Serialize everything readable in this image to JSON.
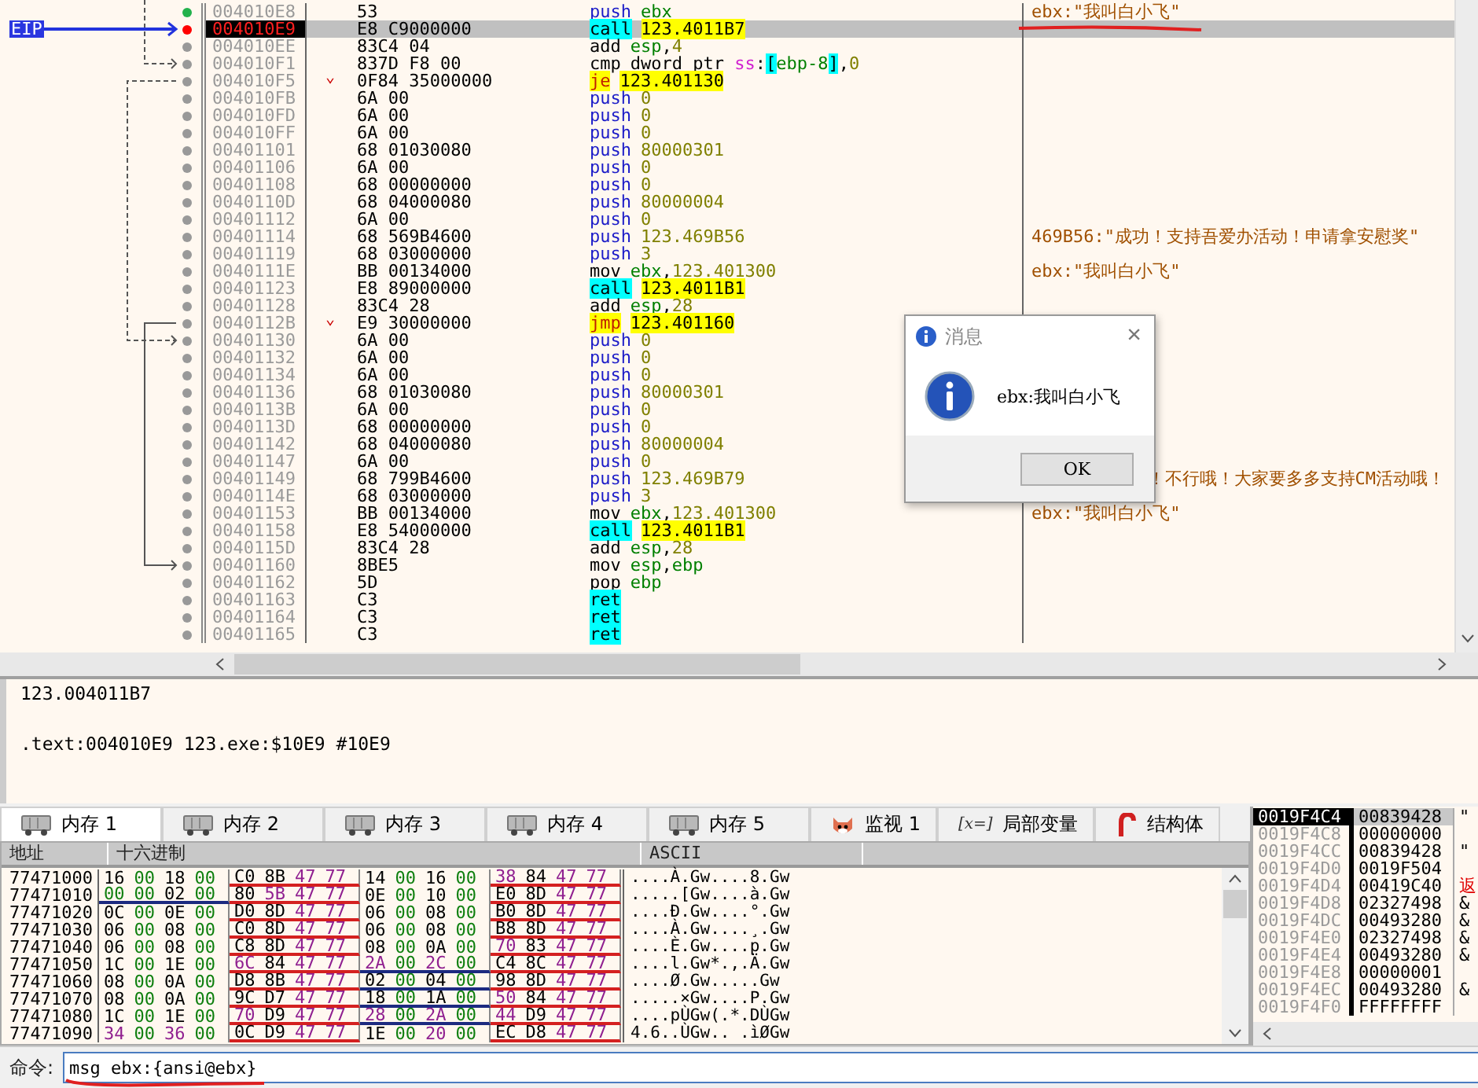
{
  "disassembly": {
    "eip_label": "EIP",
    "rows": [
      {
        "address": "004010E8",
        "bytes": "53",
        "kind": "push",
        "mnemonic": "push",
        "operand": [
          {
            "text": "ebx",
            "kind": "register"
          }
        ],
        "comment": "ebx:\"我叫白小飞\"",
        "color": "#22b14c",
        "selected": false
      },
      {
        "address": "004010E9",
        "bytes": "E8 C9000000",
        "kind": "call",
        "mnemonic": "call",
        "operand": [
          {
            "text": "123.4011B7",
            "kind": "target"
          }
        ],
        "color": "#ff0000",
        "selected": true
      },
      {
        "address": "004010EE",
        "bytes": "83C4 04",
        "kind": "plain",
        "mnemonic": "add",
        "operand": [
          {
            "text": "esp",
            "kind": "register"
          },
          {
            "text": ",",
            "kind": "plain"
          },
          {
            "text": "4",
            "kind": "number"
          }
        ],
        "color": "#999999",
        "selected": false
      },
      {
        "address": "004010F1",
        "bytes": "837D F8 00",
        "kind": "plain",
        "mnemonic": "cmp",
        "operand": [
          {
            "text": "dword ptr ",
            "kind": "plain"
          },
          {
            "text": "ss",
            "kind": "segment"
          },
          {
            "text": ":",
            "kind": "plain"
          },
          {
            "text": "[",
            "kind": "bracket"
          },
          {
            "text": "ebp-8",
            "kind": "register"
          },
          {
            "text": "]",
            "kind": "bracket"
          },
          {
            "text": ",",
            "kind": "plain"
          },
          {
            "text": "0",
            "kind": "number"
          }
        ],
        "color": "#999999",
        "selected": false
      },
      {
        "address": "004010F5",
        "bytes": "0F84 35000000",
        "jump_mark": "⌄",
        "kind": "jump",
        "mnemonic": "je",
        "operand": [
          {
            "text": "123.401130",
            "kind": "target"
          }
        ],
        "color": "#999999",
        "selected": false
      },
      {
        "address": "004010FB",
        "bytes": "6A 00",
        "kind": "push",
        "mnemonic": "push",
        "operand": [
          {
            "text": "0",
            "kind": "number"
          }
        ],
        "color": "#999999",
        "selected": false
      },
      {
        "address": "004010FD",
        "bytes": "6A 00",
        "kind": "push",
        "mnemonic": "push",
        "operand": [
          {
            "text": "0",
            "kind": "number"
          }
        ],
        "color": "#999999",
        "selected": false
      },
      {
        "address": "004010FF",
        "bytes": "6A 00",
        "kind": "push",
        "mnemonic": "push",
        "operand": [
          {
            "text": "0",
            "kind": "number"
          }
        ],
        "color": "#999999",
        "selected": false
      },
      {
        "address": "00401101",
        "bytes": "68 01030080",
        "kind": "push",
        "mnemonic": "push",
        "operand": [
          {
            "text": "80000301",
            "kind": "number"
          }
        ],
        "color": "#999999",
        "selected": false
      },
      {
        "address": "00401106",
        "bytes": "6A 00",
        "kind": "push",
        "mnemonic": "push",
        "operand": [
          {
            "text": "0",
            "kind": "number"
          }
        ],
        "color": "#999999",
        "selected": false
      },
      {
        "address": "00401108",
        "bytes": "68 00000000",
        "kind": "push",
        "mnemonic": "push",
        "operand": [
          {
            "text": "0",
            "kind": "number"
          }
        ],
        "color": "#999999",
        "selected": false
      },
      {
        "address": "0040110D",
        "bytes": "68 04000080",
        "kind": "push",
        "mnemonic": "push",
        "operand": [
          {
            "text": "80000004",
            "kind": "number"
          }
        ],
        "color": "#999999",
        "selected": false
      },
      {
        "address": "00401112",
        "bytes": "6A 00",
        "kind": "push",
        "mnemonic": "push",
        "operand": [
          {
            "text": "0",
            "kind": "number"
          }
        ],
        "color": "#999999",
        "selected": false
      },
      {
        "address": "00401114",
        "bytes": "68 569B4600",
        "kind": "push",
        "mnemonic": "push",
        "operand": [
          {
            "text": "123.469B56",
            "kind": "number"
          }
        ],
        "comment": "469B56:\"成功！支持吾爱办活动！申请拿安慰奖\"",
        "color": "#999999",
        "selected": false
      },
      {
        "address": "00401119",
        "bytes": "68 03000000",
        "kind": "push",
        "mnemonic": "push",
        "operand": [
          {
            "text": "3",
            "kind": "number"
          }
        ],
        "color": "#999999",
        "selected": false
      },
      {
        "address": "0040111E",
        "bytes": "BB 00134000",
        "kind": "plain",
        "mnemonic": "mov",
        "operand": [
          {
            "text": "ebx",
            "kind": "register"
          },
          {
            "text": ",",
            "kind": "plain"
          },
          {
            "text": "123.401300",
            "kind": "number"
          }
        ],
        "comment": "ebx:\"我叫白小飞\"",
        "color": "#999999",
        "selected": false
      },
      {
        "address": "00401123",
        "bytes": "E8 89000000",
        "kind": "call",
        "mnemonic": "call",
        "operand": [
          {
            "text": "123.4011B1",
            "kind": "target"
          }
        ],
        "color": "#999999",
        "selected": false
      },
      {
        "address": "00401128",
        "bytes": "83C4 28",
        "kind": "plain",
        "mnemonic": "add",
        "operand": [
          {
            "text": "esp",
            "kind": "register"
          },
          {
            "text": ",",
            "kind": "plain"
          },
          {
            "text": "28",
            "kind": "number"
          }
        ],
        "color": "#999999",
        "selected": false
      },
      {
        "address": "0040112B",
        "bytes": "E9 30000000",
        "jump_mark": "⌄",
        "kind": "jump",
        "mnemonic": "jmp",
        "operand": [
          {
            "text": "123.401160",
            "kind": "target"
          }
        ],
        "color": "#999999",
        "selected": false
      },
      {
        "address": "00401130",
        "bytes": "6A 00",
        "kind": "push",
        "mnemonic": "push",
        "operand": [
          {
            "text": "0",
            "kind": "number"
          }
        ],
        "color": "#999999",
        "selected": false
      },
      {
        "address": "00401132",
        "bytes": "6A 00",
        "kind": "push",
        "mnemonic": "push",
        "operand": [
          {
            "text": "0",
            "kind": "number"
          }
        ],
        "color": "#999999",
        "selected": false
      },
      {
        "address": "00401134",
        "bytes": "6A 00",
        "kind": "push",
        "mnemonic": "push",
        "operand": [
          {
            "text": "0",
            "kind": "number"
          }
        ],
        "color": "#999999",
        "selected": false
      },
      {
        "address": "00401136",
        "bytes": "68 01030080",
        "kind": "push",
        "mnemonic": "push",
        "operand": [
          {
            "text": "80000301",
            "kind": "number"
          }
        ],
        "color": "#999999",
        "selected": false
      },
      {
        "address": "0040113B",
        "bytes": "6A 00",
        "kind": "push",
        "mnemonic": "push",
        "operand": [
          {
            "text": "0",
            "kind": "number"
          }
        ],
        "color": "#999999",
        "selected": false
      },
      {
        "address": "0040113D",
        "bytes": "68 00000000",
        "kind": "push",
        "mnemonic": "push",
        "operand": [
          {
            "text": "0",
            "kind": "number"
          }
        ],
        "color": "#999999",
        "selected": false
      },
      {
        "address": "00401142",
        "bytes": "68 04000080",
        "kind": "push",
        "mnemonic": "push",
        "operand": [
          {
            "text": "80000004",
            "kind": "number"
          }
        ],
        "color": "#999999",
        "selected": false
      },
      {
        "address": "00401147",
        "bytes": "6A 00",
        "kind": "push",
        "mnemonic": "push",
        "operand": [
          {
            "text": "0",
            "kind": "number"
          }
        ],
        "color": "#999999",
        "selected": false
      },
      {
        "address": "00401149",
        "bytes": "68 799B4600",
        "kind": "push",
        "mnemonic": "push",
        "operand": [
          {
            "text": "123.469B79",
            "kind": "number"
          }
        ],
        "comment": "！不行哦！大家要多多支持CM活动哦！",
        "comment_covered": true,
        "color": "#999999",
        "selected": false
      },
      {
        "address": "0040114E",
        "bytes": "68 03000000",
        "kind": "push",
        "mnemonic": "push",
        "operand": [
          {
            "text": "3",
            "kind": "number"
          }
        ],
        "color": "#999999",
        "selected": false
      },
      {
        "address": "00401153",
        "bytes": "BB 00134000",
        "kind": "plain",
        "mnemonic": "mov",
        "operand": [
          {
            "text": "ebx",
            "kind": "register"
          },
          {
            "text": ",",
            "kind": "plain"
          },
          {
            "text": "123.401300",
            "kind": "number"
          }
        ],
        "comment": "ebx:\"我叫白小飞\"",
        "color": "#999999",
        "selected": false
      },
      {
        "address": "00401158",
        "bytes": "E8 54000000",
        "kind": "call",
        "mnemonic": "call",
        "operand": [
          {
            "text": "123.4011B1",
            "kind": "target"
          }
        ],
        "color": "#999999",
        "selected": false
      },
      {
        "address": "0040115D",
        "bytes": "83C4 28",
        "kind": "plain",
        "mnemonic": "add",
        "operand": [
          {
            "text": "esp",
            "kind": "register"
          },
          {
            "text": ",",
            "kind": "plain"
          },
          {
            "text": "28",
            "kind": "number"
          }
        ],
        "color": "#999999",
        "selected": false
      },
      {
        "address": "00401160",
        "bytes": "8BE5",
        "kind": "plain",
        "mnemonic": "mov",
        "operand": [
          {
            "text": "esp",
            "kind": "register"
          },
          {
            "text": ",",
            "kind": "plain"
          },
          {
            "text": "ebp",
            "kind": "register"
          }
        ],
        "color": "#999999",
        "selected": false
      },
      {
        "address": "00401162",
        "bytes": "5D",
        "kind": "plain",
        "mnemonic": "pop",
        "operand": [
          {
            "text": "ebp",
            "kind": "register"
          }
        ],
        "color": "#999999",
        "selected": false
      },
      {
        "address": "00401163",
        "bytes": "C3",
        "kind": "ret",
        "mnemonic": "ret",
        "color": "#999999",
        "selected": false
      },
      {
        "address": "00401164",
        "bytes": "C3",
        "kind": "ret",
        "mnemonic": "ret",
        "color": "#999999",
        "selected": false
      },
      {
        "address": "00401165",
        "bytes": "C3",
        "kind": "ret",
        "mnemonic": "ret",
        "color": "#999999",
        "selected": false
      }
    ]
  },
  "dialog": {
    "title": "消息",
    "message": "ebx:我叫白小飞",
    "button": "OK",
    "close": "×"
  },
  "info_pane": {
    "lines": [
      "123.004011B7",
      ".text:004010E9 123.exe:$10E9 #10E9"
    ]
  },
  "tabs": [
    {
      "label": "内存 1",
      "kind": "memory",
      "selected": true
    },
    {
      "label": "内存 2",
      "kind": "memory",
      "selected": false
    },
    {
      "label": "内存 3",
      "kind": "memory",
      "selected": false
    },
    {
      "label": "内存 4",
      "kind": "memory",
      "selected": false
    },
    {
      "label": "内存 5",
      "kind": "memory",
      "selected": false
    },
    {
      "label": "监视 1",
      "kind": "watch",
      "selected": false
    },
    {
      "label": "局部变量",
      "kind": "locals",
      "icon_text": "[x=]",
      "selected": false
    },
    {
      "label": "结构体",
      "kind": "struct",
      "selected": false
    }
  ],
  "dump": {
    "columns": [
      "地址",
      "十六进制",
      "ASCII"
    ],
    "rows": [
      {
        "address": "77471000",
        "groups": [
          {
            "bytes": [
              "16",
              "00",
              "18",
              "00"
            ]
          },
          {
            "bytes": [
              "C0",
              "8B",
              "47",
              "77"
            ],
            "color": "#d42020"
          },
          {
            "bytes": [
              "14",
              "00",
              "16",
              "00"
            ]
          },
          {
            "bytes": [
              "38",
              "84",
              "47",
              "77"
            ],
            "color": "#d42020"
          }
        ],
        "ascii": "....À.Gw....8.Gw"
      },
      {
        "address": "77471010",
        "groups": [
          {
            "bytes": [
              "00",
              "00",
              "02",
              "00"
            ],
            "color": "#1c2a80"
          },
          {
            "bytes": [
              "80",
              "5B",
              "47",
              "77"
            ],
            "color": "#d42020"
          },
          {
            "bytes": [
              "0E",
              "00",
              "10",
              "00"
            ]
          },
          {
            "bytes": [
              "E0",
              "8D",
              "47",
              "77"
            ],
            "color": "#d42020"
          }
        ],
        "ascii": ".....[Gw....à.Gw"
      },
      {
        "address": "77471020",
        "groups": [
          {
            "bytes": [
              "0C",
              "00",
              "0E",
              "00"
            ]
          },
          {
            "bytes": [
              "D0",
              "8D",
              "47",
              "77"
            ],
            "color": "#d42020"
          },
          {
            "bytes": [
              "06",
              "00",
              "08",
              "00"
            ]
          },
          {
            "bytes": [
              "B0",
              "8D",
              "47",
              "77"
            ],
            "color": "#d42020"
          }
        ],
        "ascii": "....Ð.Gw....°.Gw"
      },
      {
        "address": "77471030",
        "groups": [
          {
            "bytes": [
              "06",
              "00",
              "08",
              "00"
            ]
          },
          {
            "bytes": [
              "C0",
              "8D",
              "47",
              "77"
            ],
            "color": "#d42020"
          },
          {
            "bytes": [
              "06",
              "00",
              "08",
              "00"
            ]
          },
          {
            "bytes": [
              "B8",
              "8D",
              "47",
              "77"
            ],
            "color": "#d42020"
          }
        ],
        "ascii": "....À.Gw....¸.Gw"
      },
      {
        "address": "77471040",
        "groups": [
          {
            "bytes": [
              "06",
              "00",
              "08",
              "00"
            ]
          },
          {
            "bytes": [
              "C8",
              "8D",
              "47",
              "77"
            ],
            "color": "#d42020"
          },
          {
            "bytes": [
              "08",
              "00",
              "0A",
              "00"
            ]
          },
          {
            "bytes": [
              "70",
              "83",
              "47",
              "77"
            ],
            "color": "#d42020"
          }
        ],
        "ascii": "....È.Gw....p.Gw"
      },
      {
        "address": "77471050",
        "groups": [
          {
            "bytes": [
              "1C",
              "00",
              "1E",
              "00"
            ]
          },
          {
            "bytes": [
              "6C",
              "84",
              "47",
              "77"
            ],
            "color": "#d42020"
          },
          {
            "bytes": [
              "2A",
              "00",
              "2C",
              "00"
            ],
            "color": "#1c2a80"
          },
          {
            "bytes": [
              "C4",
              "8C",
              "47",
              "77"
            ],
            "color": "#d42020"
          }
        ],
        "ascii": "....l.Gw*.,.Ä.Gw"
      },
      {
        "address": "77471060",
        "groups": [
          {
            "bytes": [
              "08",
              "00",
              "0A",
              "00"
            ]
          },
          {
            "bytes": [
              "D8",
              "8B",
              "47",
              "77"
            ],
            "color": "#d42020"
          },
          {
            "bytes": [
              "02",
              "00",
              "04",
              "00"
            ],
            "color": "#1c2a80"
          },
          {
            "bytes": [
              "98",
              "8D",
              "47",
              "77"
            ],
            "color": "#d42020"
          }
        ],
        "ascii": "....Ø.Gw.....Gw"
      },
      {
        "address": "77471070",
        "groups": [
          {
            "bytes": [
              "08",
              "00",
              "0A",
              "00"
            ]
          },
          {
            "bytes": [
              "9C",
              "D7",
              "47",
              "77"
            ],
            "color": "#d42020"
          },
          {
            "bytes": [
              "18",
              "00",
              "1A",
              "00"
            ],
            "color": "#1c2a80"
          },
          {
            "bytes": [
              "50",
              "84",
              "47",
              "77"
            ],
            "color": "#d42020"
          }
        ],
        "ascii": ".....×Gw....P.Gw"
      },
      {
        "address": "77471080",
        "groups": [
          {
            "bytes": [
              "1C",
              "00",
              "1E",
              "00"
            ]
          },
          {
            "bytes": [
              "70",
              "D9",
              "47",
              "77"
            ],
            "color": "#d42020"
          },
          {
            "bytes": [
              "28",
              "00",
              "2A",
              "00"
            ],
            "color": "#1c2a80"
          },
          {
            "bytes": [
              "44",
              "D9",
              "47",
              "77"
            ],
            "color": "#d42020"
          }
        ],
        "ascii": "....pÙGw(.*.DÙGw"
      },
      {
        "address": "77471090",
        "groups": [
          {
            "bytes": [
              "34",
              "00",
              "36",
              "00"
            ]
          },
          {
            "bytes": [
              "0C",
              "D9",
              "47",
              "77"
            ],
            "color": "#d42020"
          },
          {
            "bytes": [
              "1E",
              "00",
              "20",
              "00"
            ]
          },
          {
            "bytes": [
              "EC",
              "D8",
              "47",
              "77"
            ],
            "color": "#d42020"
          }
        ],
        "ascii": "4.6..ÙGw.. .ìØGw"
      }
    ]
  },
  "stack": {
    "rows": [
      {
        "address": "0019F4C4",
        "value": "00839428",
        "comment": "\"",
        "selected": true
      },
      {
        "address": "0019F4C8",
        "value": "00000000",
        "selected": false
      },
      {
        "address": "0019F4CC",
        "value": "00839428",
        "comment": "\"",
        "selected": false
      },
      {
        "address": "0019F4D0",
        "value": "0019F504",
        "selected": false
      },
      {
        "address": "0019F4D4",
        "value": "00419C40",
        "comment": "返",
        "kind": "return",
        "selected": false
      },
      {
        "address": "0019F4D8",
        "value": "02327498",
        "comment": "&",
        "selected": false
      },
      {
        "address": "0019F4DC",
        "value": "00493280",
        "comment": "&",
        "selected": false
      },
      {
        "address": "0019F4E0",
        "value": "02327498",
        "comment": "&",
        "selected": false
      },
      {
        "address": "0019F4E4",
        "value": "00493280",
        "comment": "&",
        "selected": false
      },
      {
        "address": "0019F4E8",
        "value": "00000001",
        "selected": false
      },
      {
        "address": "0019F4EC",
        "value": "00493280",
        "comment": "&",
        "selected": false
      },
      {
        "address": "0019F4F0",
        "value": "FFFFFFFF",
        "selected": false
      }
    ]
  },
  "command": {
    "label": "命令:",
    "value": "msg ebx:{ansi@ebx}"
  }
}
